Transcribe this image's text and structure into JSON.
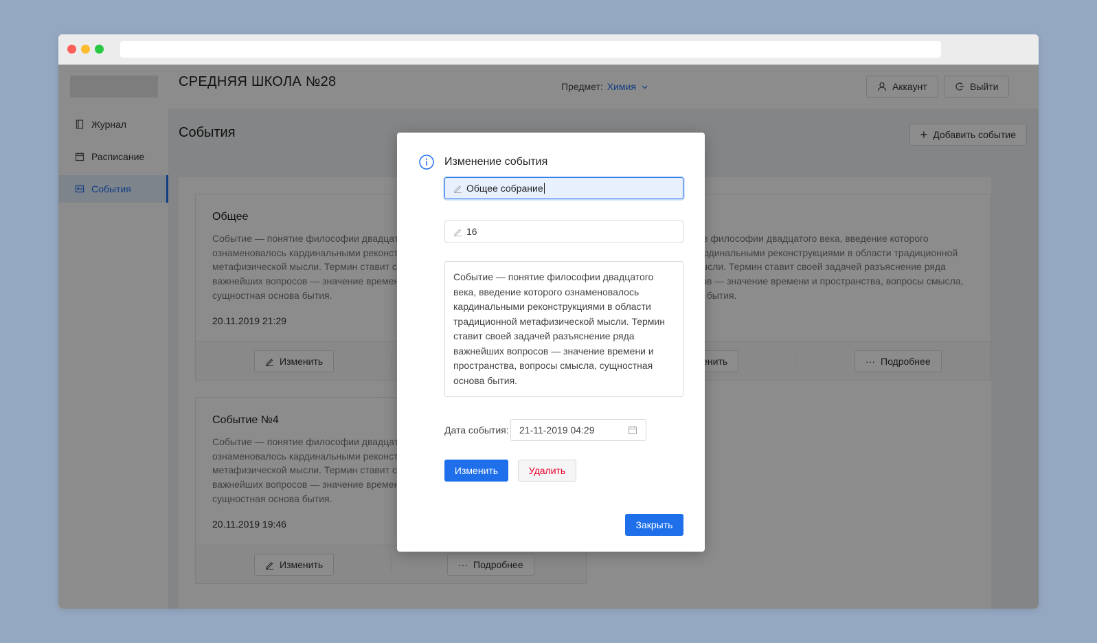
{
  "header": {
    "school_name": "СРЕДНЯЯ ШКОЛА №28",
    "subject_label": "Предмет:",
    "subject_value": "Химия",
    "account_label": "Аккаунт",
    "logout_label": "Выйти"
  },
  "sidebar": {
    "items": [
      {
        "label": "Журнал",
        "icon": "book-icon",
        "active": false
      },
      {
        "label": "Расписание",
        "icon": "calendar-icon",
        "active": false
      },
      {
        "label": "События",
        "icon": "events-icon",
        "active": true
      }
    ]
  },
  "page": {
    "title": "События",
    "add_button_label": "Добавить событие"
  },
  "cards": [
    {
      "title": "Общее",
      "text": "Событие — понятие философии двадцатого века, введение которого ознаменовалось кардинальными реконструкциями в области традиционной метафизической мысли. Термин ставит своей задачей разъяснение ряда важнейших вопросов — значение времени и пространства, вопросы смысла, сущностная основа бытия.",
      "date": "20.11.2019 21:29",
      "edit_label": "Изменить",
      "details_label": "Подробнее"
    },
    {
      "title": "",
      "text": "Событие — понятие философии двадцатого века, введение которого ознаменовалось кардинальными реконструкциями в области традиционной метафизической мысли. Термин ставит своей задачей разъяснение ряда важнейших вопросов — значение времени и пространства, вопросы смысла, сущностная основа бытия.",
      "date": "",
      "edit_label": "Изменить",
      "details_label": "Подробнее"
    },
    {
      "title": "Событие №4",
      "text": "Событие — понятие философии двадцатого века, введение которого ознаменовалось кардинальными реконструкциями в области традиционной метафизической мысли. Термин ставит своей задачей разъяснение ряда важнейших вопросов — значение времени и пространства, вопросы смысла, сущностная основа бытия.",
      "date": "20.11.2019 19:46",
      "edit_label": "Изменить",
      "details_label": "Подробнее"
    }
  ],
  "modal": {
    "title": "Изменение события",
    "name_value": "Общее собрание",
    "number_value": "16",
    "description_value": "Событие — понятие философии двадцатого века, введение которого ознаменовалось кардинальными реконструкциями в области традиционной метафизической мысли. Термин ставит своей задачей разъяснение ряда важнейших вопросов — значение времени и пространства, вопросы смысла, сущностная основа бытия.",
    "date_label": "Дата события:",
    "date_value": "21-11-2019 04:29",
    "save_label": "Изменить",
    "delete_label": "Удалить",
    "close_label": "Закрыть"
  },
  "colors": {
    "accent": "#1f6feb",
    "danger": "#e5002b",
    "background": "#95a8c2"
  }
}
